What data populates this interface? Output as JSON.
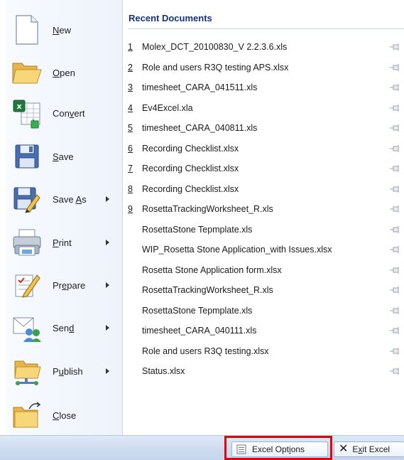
{
  "commands": [
    {
      "id": "new",
      "label_pre": "",
      "label_ul": "N",
      "label_post": "ew",
      "has_arrow": false,
      "icon": "new-document-icon"
    },
    {
      "id": "open",
      "label_pre": "",
      "label_ul": "O",
      "label_post": "pen",
      "has_arrow": false,
      "icon": "open-folder-icon"
    },
    {
      "id": "convert",
      "label_pre": "Con",
      "label_ul": "v",
      "label_post": "ert",
      "has_arrow": false,
      "icon": "convert-icon"
    },
    {
      "id": "save",
      "label_pre": "",
      "label_ul": "S",
      "label_post": "ave",
      "has_arrow": false,
      "icon": "save-disk-icon"
    },
    {
      "id": "save-as",
      "label_pre": "Save ",
      "label_ul": "A",
      "label_post": "s",
      "has_arrow": true,
      "icon": "save-as-icon"
    },
    {
      "id": "print",
      "label_pre": "",
      "label_ul": "P",
      "label_post": "rint",
      "has_arrow": true,
      "icon": "printer-icon"
    },
    {
      "id": "prepare",
      "label_pre": "Pr",
      "label_ul": "e",
      "label_post": "pare",
      "has_arrow": true,
      "icon": "prepare-icon"
    },
    {
      "id": "send",
      "label_pre": "Sen",
      "label_ul": "d",
      "label_post": "",
      "has_arrow": true,
      "icon": "send-icon"
    },
    {
      "id": "publish",
      "label_pre": "P",
      "label_ul": "u",
      "label_post": "blish",
      "has_arrow": true,
      "icon": "publish-icon"
    },
    {
      "id": "close",
      "label_pre": "",
      "label_ul": "C",
      "label_post": "lose",
      "has_arrow": false,
      "icon": "close-folder-icon"
    }
  ],
  "recent": {
    "header": "Recent Documents",
    "items": [
      {
        "num": "1",
        "name": "Molex_DCT_20100830_V 2.2.3.6.xls"
      },
      {
        "num": "2",
        "name": "Role and users R3Q testing APS.xlsx"
      },
      {
        "num": "3",
        "name": "timesheet_CARA_041511.xls"
      },
      {
        "num": "4",
        "name": "Ev4Excel.xla"
      },
      {
        "num": "5",
        "name": "timesheet_CARA_040811.xls"
      },
      {
        "num": "6",
        "name": "Recording Checklist.xlsx"
      },
      {
        "num": "7",
        "name": "Recording Checklist.xlsx"
      },
      {
        "num": "8",
        "name": "Recording Checklist.xlsx"
      },
      {
        "num": "9",
        "name": "RosettaTrackingWorksheet_R.xls"
      },
      {
        "num": "",
        "name": "RosettaStone Tepmplate.xls"
      },
      {
        "num": "",
        "name": "WIP_Rosetta Stone Application_with Issues.xlsx"
      },
      {
        "num": "",
        "name": "Rosetta Stone Application form.xlsx"
      },
      {
        "num": "",
        "name": "RosettaTrackingWorksheet_R.xls"
      },
      {
        "num": "",
        "name": "RosettaStone Tepmplate.xls"
      },
      {
        "num": "",
        "name": "timesheet_CARA_040111.xls"
      },
      {
        "num": "",
        "name": "Role and users R3Q testing.xlsx"
      },
      {
        "num": "",
        "name": "Status.xlsx"
      }
    ]
  },
  "bottom": {
    "options_pre": "Excel Opt",
    "options_ul": "i",
    "options_post": "ons",
    "exit_pre": "E",
    "exit_ul": "x",
    "exit_post": "it Excel"
  },
  "colors": {
    "highlight": "#e8000b",
    "header_text": "#15317e"
  }
}
